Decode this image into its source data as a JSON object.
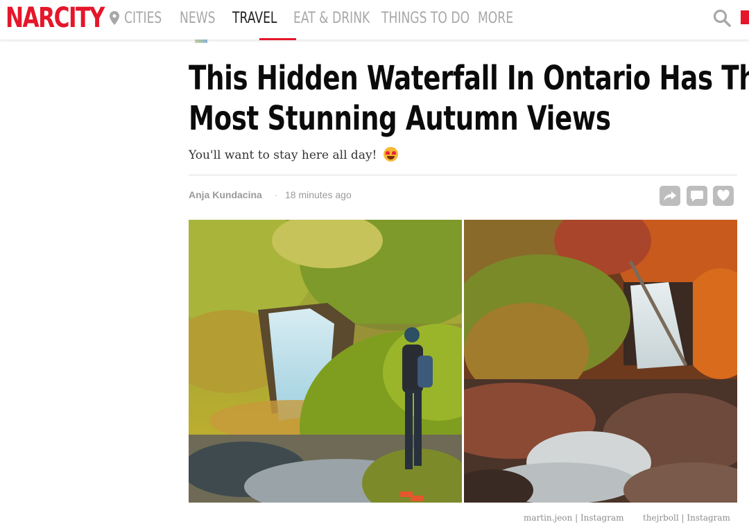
{
  "brand": {
    "logo_text": "NARCITY",
    "accent_color": "#e5162b"
  },
  "nav": {
    "items": [
      {
        "label": "CITIES",
        "icon": "map-pin-icon"
      },
      {
        "label": "NEWS"
      },
      {
        "label": "TRAVEL",
        "active": true
      },
      {
        "label": "EAT & DRINK"
      },
      {
        "label": "THINGS TO DO"
      },
      {
        "label": "MORE"
      }
    ],
    "search_icon": "search-icon"
  },
  "article": {
    "headline_line1": "This Hidden Waterfall In Ontario Has The",
    "headline_line2": "Most Stunning Autumn Views",
    "subtitle": "You'll want to stay here all day!",
    "subtitle_emoji": "heart-eyes-emoji",
    "author": "Anja Kundacina",
    "separator": "·",
    "time_ago": "18 minutes ago",
    "actions": [
      "share-icon",
      "comment-icon",
      "heart-icon"
    ],
    "images": [
      {
        "credit": "martin.jeon | Instagram"
      },
      {
        "credit": "thejrboll | Instagram"
      }
    ]
  }
}
